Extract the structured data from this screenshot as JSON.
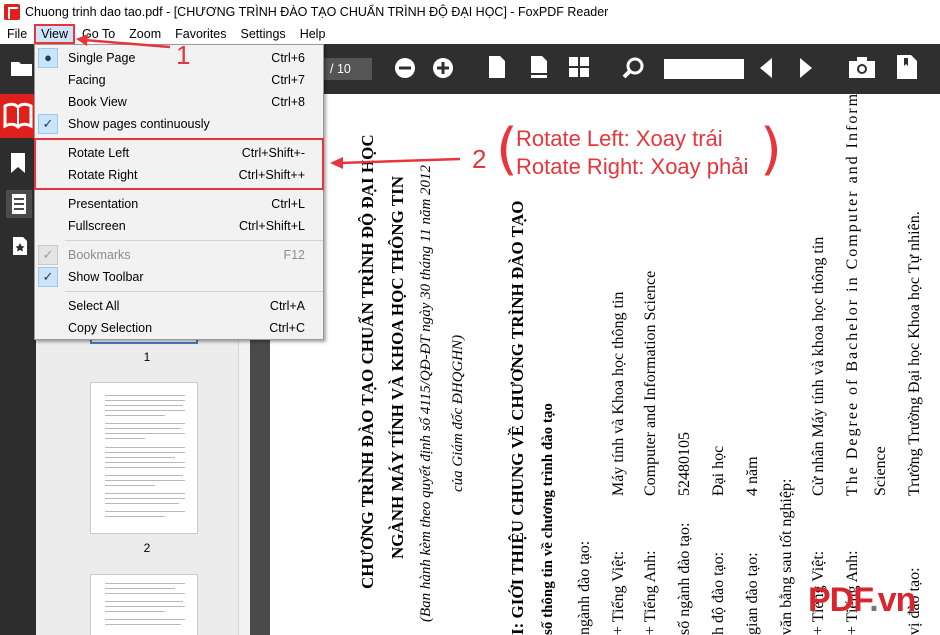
{
  "window": {
    "title": "Chuong trinh dao tao.pdf - [CHƯƠNG TRÌNH ĐÀO TẠO CHUẨN TRÌNH ĐỘ ĐẠI HỌC] - FoxPDF Reader"
  },
  "menubar": [
    "File",
    "View",
    "Go To",
    "Zoom",
    "Favorites",
    "Settings",
    "Help"
  ],
  "toolbar": {
    "page_total": "/ 10"
  },
  "view_menu": {
    "items": [
      {
        "label": "Single Page",
        "shortcut": "Ctrl+6"
      },
      {
        "label": "Facing",
        "shortcut": "Ctrl+7"
      },
      {
        "label": "Book View",
        "shortcut": "Ctrl+8"
      },
      {
        "label": "Show pages continuously",
        "shortcut": ""
      },
      {
        "label": "Rotate Left",
        "shortcut": "Ctrl+Shift+-"
      },
      {
        "label": "Rotate Right",
        "shortcut": "Ctrl+Shift++"
      },
      {
        "label": "Presentation",
        "shortcut": "Ctrl+L"
      },
      {
        "label": "Fullscreen",
        "shortcut": "Ctrl+Shift+L"
      },
      {
        "label": "Bookmarks",
        "shortcut": "F12"
      },
      {
        "label": "Show Toolbar",
        "shortcut": ""
      },
      {
        "label": "Select All",
        "shortcut": "Ctrl+A"
      },
      {
        "label": "Copy Selection",
        "shortcut": "Ctrl+C"
      }
    ]
  },
  "thumbnails": {
    "labels": [
      "1",
      "2"
    ]
  },
  "annotations": {
    "step1": "1",
    "step2": "2",
    "rotate_left_note": "Rotate Left: Xoay trái",
    "rotate_right_note": "Rotate Right: Xoay phải"
  },
  "watermark": {
    "brand": "PDF",
    "dot": ".",
    "tld": "vn"
  },
  "document": {
    "lines": [
      "CHƯƠNG TRÌNH ĐÀO TẠO CHUẨN TRÌNH ĐỘ ĐẠI HỌC",
      "NGÀNH MÁY TÍNH VÀ KHOA HỌC THÔNG TIN",
      "(Ban hành kèm theo quyết định số 4115/QĐ-ĐT ngày 30 tháng 11 năm 2012",
      "của Giám đốc ĐHQGHN)",
      "I: GIỚI THIỆU CHUNG VỀ CHƯƠNG TRÌNH ĐÀO TẠO",
      "số thông tin về chương trình đào tạo",
      "ngành đào tạo:",
      "+ Tiếng Việt:",
      "Máy tính và Khoa học thông tin",
      "+ Tiếng Anh:",
      "Computer and Information Science",
      "số ngành đào tạo:",
      "52480105",
      "h độ đào tạo:",
      "Đại học",
      "gian đào tạo:",
      "4 năm",
      "văn bằng sau tốt nghiệp:",
      "+ Tiếng Việt:",
      "Cử nhân Máy tính và khoa học thông tin",
      "+ Tiếng Anh:",
      "The Degree of Bachelor in Computer and Information",
      "Science",
      "vị đào tạo:",
      "Trường Trường Đại học Khoa học Tự nhiên."
    ]
  }
}
